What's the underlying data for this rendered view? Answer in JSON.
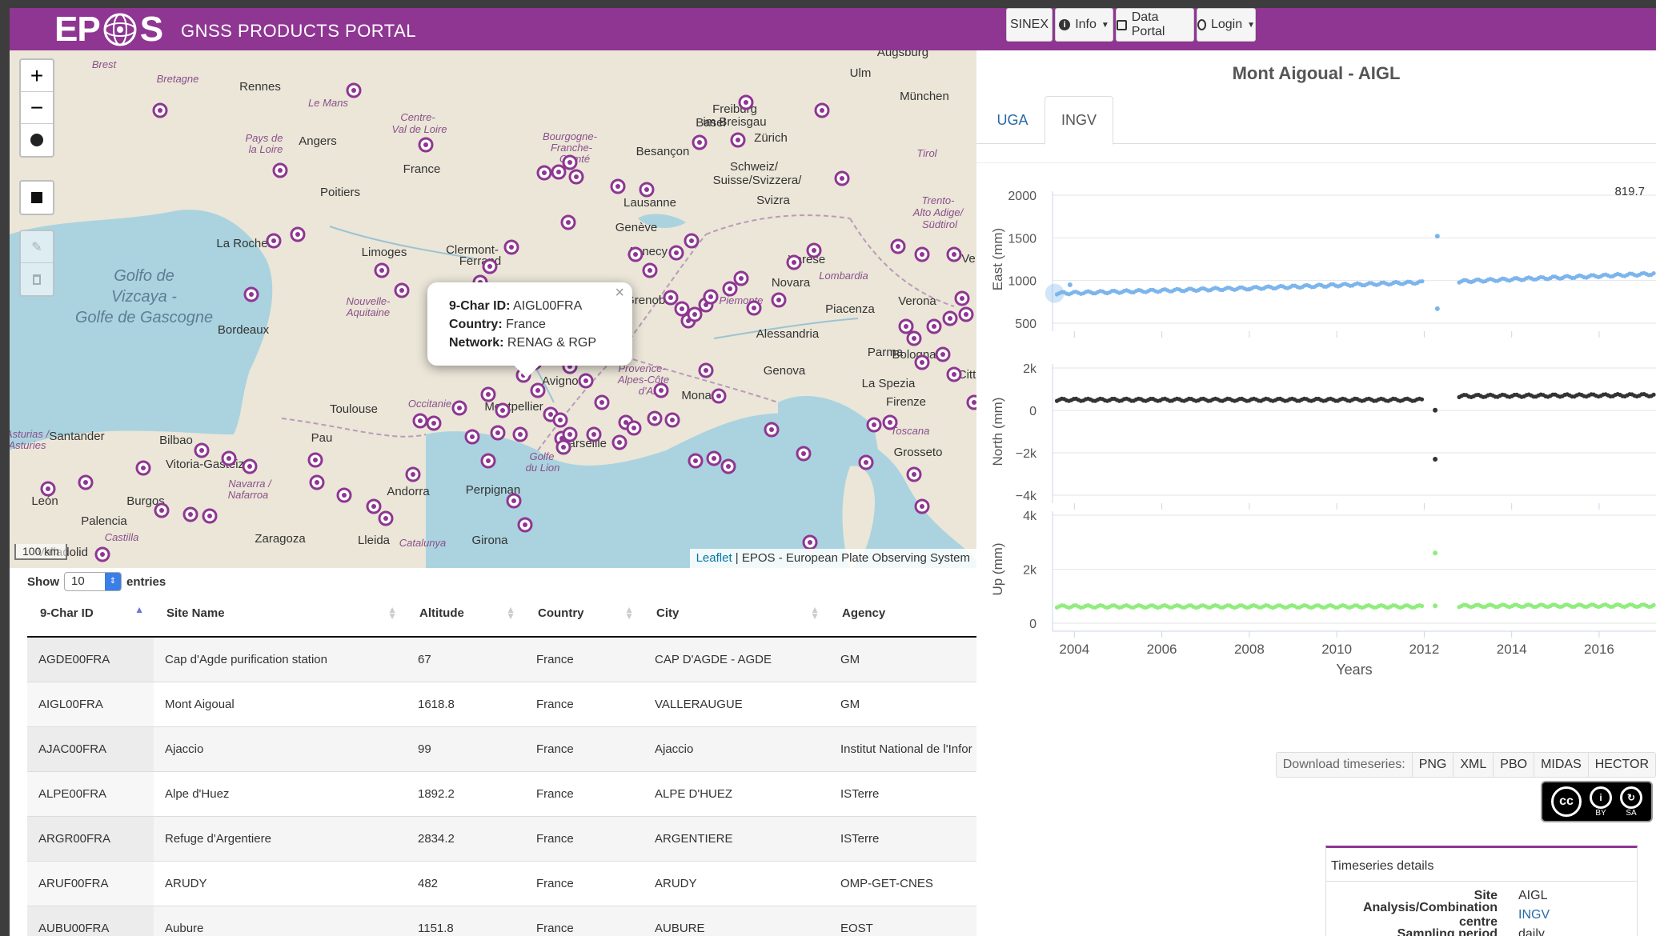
{
  "navbar": {
    "logo_pre": "EP",
    "logo_post": "S",
    "title": "GNSS PRODUCTS PORTAL",
    "sinex": "SINEX",
    "info": "Info",
    "data_portal": "Data Portal",
    "login": "Login"
  },
  "map": {
    "labels": [
      {
        "t": "Brest"
      },
      {
        "t": "Bretagne"
      },
      {
        "t": "Rennes"
      },
      {
        "t": "Le Mans"
      },
      {
        "t": "Centre-"
      },
      {
        "t": "Val de Loire"
      },
      {
        "t": "Pays de"
      },
      {
        "t": "la Loire"
      },
      {
        "t": "Angers"
      },
      {
        "t": "France"
      },
      {
        "t": "Poitiers"
      },
      {
        "t": "La Rochelle"
      },
      {
        "t": "Limoges"
      },
      {
        "t": "Clermont-"
      },
      {
        "t": "Ferrand"
      },
      {
        "t": "Golfo de"
      },
      {
        "t": "Vizcaya -"
      },
      {
        "t": "Golfe de Gascogne"
      },
      {
        "t": "Bordeaux"
      },
      {
        "t": "Nouvelle-"
      },
      {
        "t": "Aquitaine"
      },
      {
        "t": "Toulouse"
      },
      {
        "t": "Occitanie"
      },
      {
        "t": "Montpellier"
      },
      {
        "t": "Avignon"
      },
      {
        "t": "Marseille"
      },
      {
        "t": "Golfe"
      },
      {
        "t": "du Lion"
      },
      {
        "t": "Provence-"
      },
      {
        "t": "Alpes-Côte"
      },
      {
        "t": "d'Azur"
      },
      {
        "t": "Monaco"
      },
      {
        "t": "Genova"
      },
      {
        "t": "Bourgogne-"
      },
      {
        "t": "Franche-"
      },
      {
        "t": "Comté"
      },
      {
        "t": "Besançon"
      },
      {
        "t": "Lausanne"
      },
      {
        "t": "Genève"
      },
      {
        "t": "Annecy"
      },
      {
        "t": "Grenoble"
      },
      {
        "t": "Schweiz/"
      },
      {
        "t": "Suisse/Svizzera/"
      },
      {
        "t": "Svizra"
      },
      {
        "t": "Zürich"
      },
      {
        "t": "Basel"
      },
      {
        "t": "Freiburg"
      },
      {
        "t": "im Breisgau"
      },
      {
        "t": "Ulm"
      },
      {
        "t": "Augsburg"
      },
      {
        "t": "München"
      },
      {
        "t": "Tirol"
      },
      {
        "t": "Trento-"
      },
      {
        "t": "Alto Adige/"
      },
      {
        "t": "Südtirol"
      },
      {
        "t": "Varese"
      },
      {
        "t": "Novara"
      },
      {
        "t": "Lombardia"
      },
      {
        "t": "Piemonte"
      },
      {
        "t": "Verona"
      },
      {
        "t": "Piacenza"
      },
      {
        "t": "Alessandria"
      },
      {
        "t": "Parma"
      },
      {
        "t": "Bologna"
      },
      {
        "t": "La Spezia"
      },
      {
        "t": "Firenze"
      },
      {
        "t": "Toscana"
      },
      {
        "t": "Grosseto"
      },
      {
        "t": "Santander"
      },
      {
        "t": "Bilbao"
      },
      {
        "t": "Asturias /"
      },
      {
        "t": "Asturies"
      },
      {
        "t": "Vitoria-Gasteiz"
      },
      {
        "t": "Pau"
      },
      {
        "t": "Navarra /"
      },
      {
        "t": "Nafarroa"
      },
      {
        "t": "León"
      },
      {
        "t": "Burgos"
      },
      {
        "t": "Palencia"
      },
      {
        "t": "Andorra"
      },
      {
        "t": "Perpignan"
      },
      {
        "t": "Zaragoza"
      },
      {
        "t": "Lleida"
      },
      {
        "t": "Catalunya"
      },
      {
        "t": "Girona"
      },
      {
        "t": "Castilla"
      },
      {
        "t": "Valladolid"
      },
      {
        "t": "Citt"
      },
      {
        "t": "Ve"
      }
    ],
    "popup": {
      "id_label": "9-Char ID:",
      "id": "AIGL00FRA",
      "country_label": "Country:",
      "country": "France",
      "network_label": "Network:",
      "network": "RENAG & RGP",
      "close": "×"
    },
    "scale": "100 km",
    "attribution_link": "Leaflet",
    "attribution_text": " | EPOS - European Plate Observing System",
    "controls": {
      "zoom_in": "+",
      "zoom_out": "−"
    }
  },
  "table": {
    "show": "Show",
    "entries": "entries",
    "page_size": "10",
    "columns": [
      "9-Char ID",
      "Site Name",
      "Altitude",
      "Country",
      "City",
      "Agency"
    ],
    "rows": [
      [
        "AGDE00FRA",
        "Cap d'Agde purification station",
        "67",
        "France",
        "CAP D'AGDE - AGDE",
        "GM"
      ],
      [
        "AIGL00FRA",
        "Mont Aigoual",
        "1618.8",
        "France",
        "VALLERAUGUE",
        "GM"
      ],
      [
        "AJAC00FRA",
        "Ajaccio",
        "99",
        "France",
        "Ajaccio",
        "Institut National de l'Infor"
      ],
      [
        "ALPE00FRA",
        "Alpe d'Huez",
        "1892.2",
        "France",
        "ALPE D'HUEZ",
        "ISTerre"
      ],
      [
        "ARGR00FRA",
        "Refuge d'Argentiere",
        "2834.2",
        "France",
        "ARGENTIERE",
        "ISTerre"
      ],
      [
        "ARUF00FRA",
        "ARUDY",
        "482",
        "France",
        "ARUDY",
        "OMP-GET-CNES"
      ],
      [
        "AUBU00FRA",
        "Aubure",
        "1151.8",
        "France",
        "AUBURE",
        "EOST"
      ]
    ]
  },
  "right": {
    "station_title": "Mont Aigoual - AIGL",
    "tabs": [
      "UGA",
      "INGV"
    ],
    "download_label": "Download timeseries:",
    "downloads": [
      "PNG",
      "XML",
      "PBO",
      "MIDAS",
      "HECTOR"
    ],
    "cc": {
      "by": "BY",
      "sa": "SA"
    },
    "details": {
      "header": "Timeseries details",
      "rows": [
        {
          "k": "Site",
          "v": "AIGL"
        },
        {
          "k": "Analysis/Combination centre",
          "v": "INGV"
        },
        {
          "k": "Sampling period",
          "v": "daily"
        }
      ]
    }
  },
  "chart_data": {
    "type": "scatter",
    "xlabel": "Years",
    "x_ticks": [
      "2004",
      "2006",
      "2008",
      "2010",
      "2012",
      "2014",
      "2016"
    ],
    "xlim": [
      2003.5,
      2017.3
    ],
    "annotation": "819.7",
    "series": [
      {
        "ylabel": "East (mm)",
        "color": "#7cb5ec",
        "ylim": [
          500,
          2000
        ],
        "yticks": [
          "2000",
          "1500",
          "1000",
          "500"
        ],
        "segments": [
          [
            2003.6,
            2008.0,
            850,
            910
          ],
          [
            2008.0,
            2012.0,
            910,
            980
          ],
          [
            2012.8,
            2017.3,
            990,
            1080
          ]
        ],
        "outliers": [
          [
            2012.3,
            1520
          ],
          [
            2012.3,
            670
          ],
          [
            2003.9,
            950
          ]
        ]
      },
      {
        "ylabel": "North (mm)",
        "color": "#333333",
        "ylim": [
          -4000,
          2000
        ],
        "yticks": [
          "2k",
          "0",
          "−2k",
          "−4k"
        ],
        "segments": [
          [
            2003.6,
            2012.0,
            500,
            500
          ],
          [
            2012.8,
            2017.3,
            680,
            720
          ]
        ],
        "outliers": [
          [
            2012.25,
            10
          ],
          [
            2012.25,
            -2300
          ]
        ]
      },
      {
        "ylabel": "Up (mm)",
        "color": "#90ed7d",
        "ylim": [
          0,
          4000
        ],
        "yticks": [
          "4k",
          "2k",
          "0"
        ],
        "segments": [
          [
            2003.6,
            2012.0,
            620,
            620
          ],
          [
            2012.8,
            2017.3,
            640,
            650
          ]
        ],
        "outliers": [
          [
            2012.25,
            2600
          ],
          [
            2012.25,
            640
          ]
        ]
      }
    ]
  }
}
